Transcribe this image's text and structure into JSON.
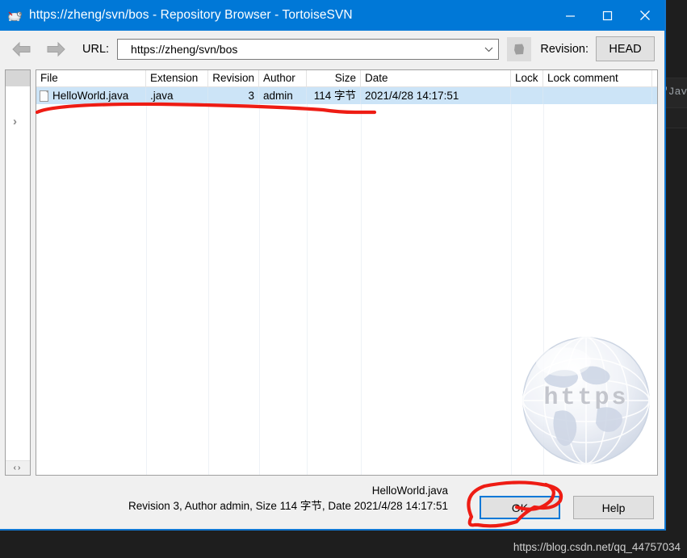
{
  "window": {
    "title": "https://zheng/svn/bos - Repository Browser - TortoiseSVN",
    "app_icon": "tortoise-svn-icon",
    "minimize_label": "–",
    "maximize_label": "□",
    "close_label": "✕",
    "titlebar_color": "#0078d7"
  },
  "toolbar": {
    "back_label": "back-arrow",
    "forward_label": "forward-arrow",
    "url_label": "URL:",
    "url_value": "https://zheng/svn/bos",
    "url_dropdown_glyph": "∨",
    "refresh_label": "refresh",
    "revision_label": "Revision:",
    "revision_value": "HEAD"
  },
  "tree_pane": {
    "expander_glyph": "›",
    "scroll_left_glyph": "‹",
    "scroll_right_glyph": "›"
  },
  "list": {
    "sort_caret": "ⱏ",
    "columns": [
      {
        "label": "File",
        "width": 136,
        "align": "left"
      },
      {
        "label": "Extension",
        "width": 77,
        "align": "left"
      },
      {
        "label": "Revision",
        "width": 63,
        "align": "right"
      },
      {
        "label": "Author",
        "width": 59,
        "align": "left"
      },
      {
        "label": "Size",
        "width": 67,
        "align": "right"
      },
      {
        "label": "Date",
        "width": 186,
        "align": "left"
      },
      {
        "label": "Lock",
        "width": 40,
        "align": "left"
      },
      {
        "label": "Lock comment",
        "width": 135,
        "align": "left"
      }
    ],
    "rows": [
      {
        "icon": "file-icon",
        "file": "HelloWorld.java",
        "extension": ".java",
        "revision": "3",
        "author": "admin",
        "size": "114 字节",
        "date": "2021/4/28 14:17:51",
        "lock": "",
        "lock_comment": "",
        "selected": true
      }
    ]
  },
  "watermark": {
    "globe_text": "https"
  },
  "status": {
    "file_name": "HelloWorld.java",
    "detail": "Revision 3, Author admin, Size 114 字节, Date 2021/4/28 14:17:51"
  },
  "buttons": {
    "ok": "OK",
    "help": "Help"
  },
  "background": {
    "code_snippet": "\"Jav"
  },
  "overlay": {
    "blog_url": "https://blog.csdn.net/qq_44757034"
  },
  "annotations": {
    "underline_color": "#ee1c14",
    "circle_color": "#ee1c14"
  }
}
